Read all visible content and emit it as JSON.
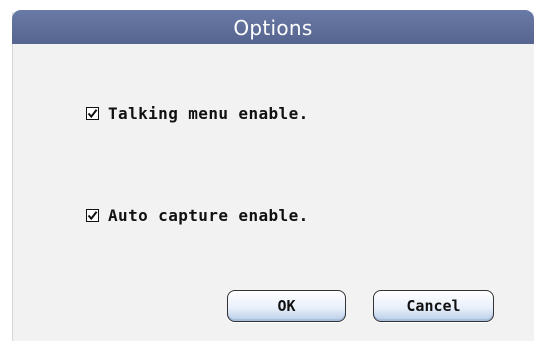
{
  "dialog": {
    "title": "Options",
    "title_bar_color": "#5c6c97"
  },
  "options": [
    {
      "label": "Talking menu enable.",
      "checked": true
    },
    {
      "label": "Auto capture enable.",
      "checked": true
    }
  ],
  "buttons": {
    "ok_label": "OK",
    "cancel_label": "Cancel"
  }
}
